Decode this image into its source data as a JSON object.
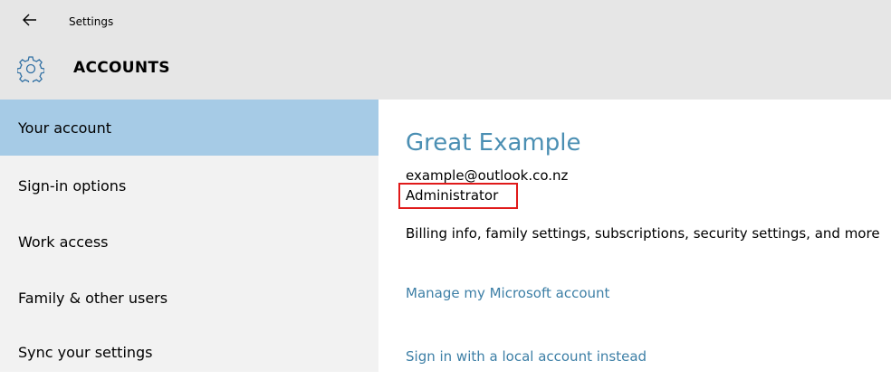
{
  "window": {
    "title": "Settings",
    "back_icon": "back-arrow-icon"
  },
  "section": {
    "title": "ACCOUNTS",
    "icon": "gear-icon",
    "accent_color": "#4b8fb3"
  },
  "sidebar": {
    "items": [
      {
        "label": "Your account",
        "selected": true
      },
      {
        "label": "Sign-in options",
        "selected": false
      },
      {
        "label": "Work access",
        "selected": false
      },
      {
        "label": "Family & other users",
        "selected": false
      },
      {
        "label": "Sync your settings",
        "selected": false
      }
    ],
    "selected_color": "#a6cbe6"
  },
  "account": {
    "display_name": "Great Example",
    "email": "example@outlook.co.nz",
    "role": "Administrator",
    "billing_description": "Billing info, family settings, subscriptions, security settings, and more",
    "manage_link": "Manage my Microsoft account",
    "local_account_link": "Sign in with a local account instead"
  }
}
